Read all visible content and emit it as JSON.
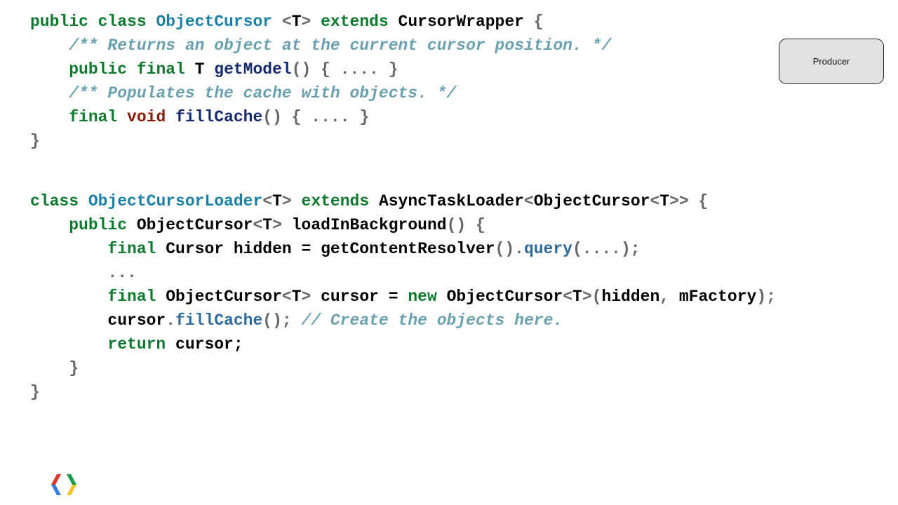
{
  "callout": {
    "label": "Producer"
  },
  "code": {
    "lines": [
      {
        "indent": 0,
        "tokens": [
          {
            "t": "public class ",
            "c": "kw"
          },
          {
            "t": "ObjectCursor",
            "c": "type"
          },
          {
            "t": " <",
            "c": "pun"
          },
          {
            "t": "T",
            "c": "id"
          },
          {
            "t": "> ",
            "c": "pun"
          },
          {
            "t": "extends",
            "c": "kw"
          },
          {
            "t": " CursorWrapper",
            "c": "id"
          },
          {
            "t": " {",
            "c": "pun"
          }
        ]
      },
      {
        "indent": 4,
        "tokens": [
          {
            "t": "/** Returns an object at the current cursor position. */",
            "c": "cmt"
          }
        ]
      },
      {
        "indent": 4,
        "tokens": [
          {
            "t": "public final ",
            "c": "kw"
          },
          {
            "t": "T ",
            "c": "id"
          },
          {
            "t": "getModel",
            "c": "fn"
          },
          {
            "t": "() { .... }",
            "c": "pun"
          }
        ]
      },
      {
        "indent": 4,
        "tokens": [
          {
            "t": "/** Populates the cache with objects. */",
            "c": "cmt"
          }
        ]
      },
      {
        "indent": 4,
        "tokens": [
          {
            "t": "final ",
            "c": "kw"
          },
          {
            "t": "void ",
            "c": "kw2"
          },
          {
            "t": "fillCache",
            "c": "fn"
          },
          {
            "t": "() { .... }",
            "c": "pun"
          }
        ]
      },
      {
        "indent": 0,
        "tokens": [
          {
            "t": "}",
            "c": "pun"
          }
        ]
      },
      {
        "indent": 0,
        "blank": true,
        "tokens": []
      },
      {
        "indent": 0,
        "tokens": [
          {
            "t": "class ",
            "c": "kw"
          },
          {
            "t": "ObjectCursorLoader",
            "c": "type"
          },
          {
            "t": "<",
            "c": "pun"
          },
          {
            "t": "T",
            "c": "id"
          },
          {
            "t": "> ",
            "c": "pun"
          },
          {
            "t": "extends ",
            "c": "kw"
          },
          {
            "t": "AsyncTaskLoader",
            "c": "id"
          },
          {
            "t": "<",
            "c": "pun"
          },
          {
            "t": "ObjectCursor",
            "c": "id"
          },
          {
            "t": "<",
            "c": "pun"
          },
          {
            "t": "T",
            "c": "id"
          },
          {
            "t": ">> {",
            "c": "pun"
          }
        ]
      },
      {
        "indent": 4,
        "tokens": [
          {
            "t": "public ",
            "c": "kw"
          },
          {
            "t": "ObjectCursor",
            "c": "id"
          },
          {
            "t": "<",
            "c": "pun"
          },
          {
            "t": "T",
            "c": "id"
          },
          {
            "t": "> ",
            "c": "pun"
          },
          {
            "t": "loadInBackground",
            "c": "id"
          },
          {
            "t": "() {",
            "c": "pun"
          }
        ]
      },
      {
        "indent": 8,
        "tokens": [
          {
            "t": "final ",
            "c": "kw"
          },
          {
            "t": "Cursor hidden = getContentResolver",
            "c": "id"
          },
          {
            "t": "().",
            "c": "pun"
          },
          {
            "t": "query",
            "c": "call"
          },
          {
            "t": "(....);",
            "c": "pun"
          }
        ]
      },
      {
        "indent": 8,
        "tokens": [
          {
            "t": "...",
            "c": "pun"
          }
        ]
      },
      {
        "indent": 8,
        "tokens": [
          {
            "t": "final ",
            "c": "kw"
          },
          {
            "t": "ObjectCursor",
            "c": "id"
          },
          {
            "t": "<",
            "c": "pun"
          },
          {
            "t": "T",
            "c": "id"
          },
          {
            "t": "> ",
            "c": "pun"
          },
          {
            "t": "cursor = ",
            "c": "id"
          },
          {
            "t": "new ",
            "c": "kw"
          },
          {
            "t": "ObjectCursor",
            "c": "id"
          },
          {
            "t": "<",
            "c": "pun"
          },
          {
            "t": "T",
            "c": "id"
          },
          {
            "t": ">(",
            "c": "pun"
          },
          {
            "t": "hidden",
            "c": "id"
          },
          {
            "t": ", ",
            "c": "pun"
          },
          {
            "t": "mFactory",
            "c": "id"
          },
          {
            "t": ");",
            "c": "pun"
          }
        ]
      },
      {
        "indent": 8,
        "tokens": [
          {
            "t": "cursor",
            "c": "id"
          },
          {
            "t": ".",
            "c": "pun"
          },
          {
            "t": "fillCache",
            "c": "call"
          },
          {
            "t": "(); ",
            "c": "pun"
          },
          {
            "t": "// Create the objects here.",
            "c": "cmt"
          }
        ]
      },
      {
        "indent": 8,
        "tokens": [
          {
            "t": "return ",
            "c": "kw"
          },
          {
            "t": "cursor;",
            "c": "id"
          }
        ]
      },
      {
        "indent": 4,
        "tokens": [
          {
            "t": "}",
            "c": "pun"
          }
        ]
      },
      {
        "indent": 0,
        "tokens": [
          {
            "t": "}",
            "c": "pun"
          }
        ]
      }
    ]
  },
  "colors": {
    "keyword": "#0d7a2e",
    "void_keyword": "#8a1c06",
    "type_name": "#1a80a8",
    "method_decl": "#152a6e",
    "method_call": "#2e6a9a",
    "comment": "#6aa1b0",
    "punctuation": "#666666"
  },
  "logo": {
    "icon": "google-developers-chevron-icon"
  }
}
